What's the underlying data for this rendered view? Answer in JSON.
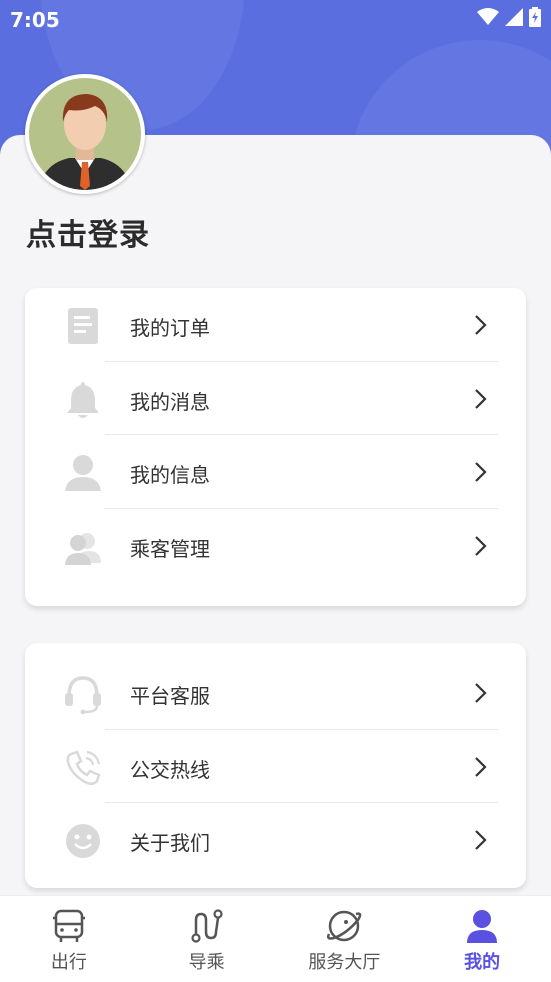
{
  "status_bar": {
    "time": "7:05"
  },
  "profile": {
    "login_label": "点击登录"
  },
  "menu_group_1": [
    {
      "label": "我的订单",
      "icon": "document-icon"
    },
    {
      "label": "我的消息",
      "icon": "bell-icon"
    },
    {
      "label": "我的信息",
      "icon": "user-icon"
    },
    {
      "label": "乘客管理",
      "icon": "users-icon"
    }
  ],
  "menu_group_2": [
    {
      "label": "平台客服",
      "icon": "headset-icon"
    },
    {
      "label": "公交热线",
      "icon": "phone-icon"
    },
    {
      "label": "关于我们",
      "icon": "smiley-icon"
    }
  ],
  "tabbar": [
    {
      "label": "出行",
      "icon": "bus-icon",
      "active": false
    },
    {
      "label": "导乘",
      "icon": "route-icon",
      "active": false
    },
    {
      "label": "服务大厅",
      "icon": "planet-icon",
      "active": false
    },
    {
      "label": "我的",
      "icon": "profile-icon",
      "active": true
    }
  ],
  "colors": {
    "header": "#5a6ee0",
    "accent": "#5a51e0",
    "icon_grey": "#d9d9d9"
  }
}
